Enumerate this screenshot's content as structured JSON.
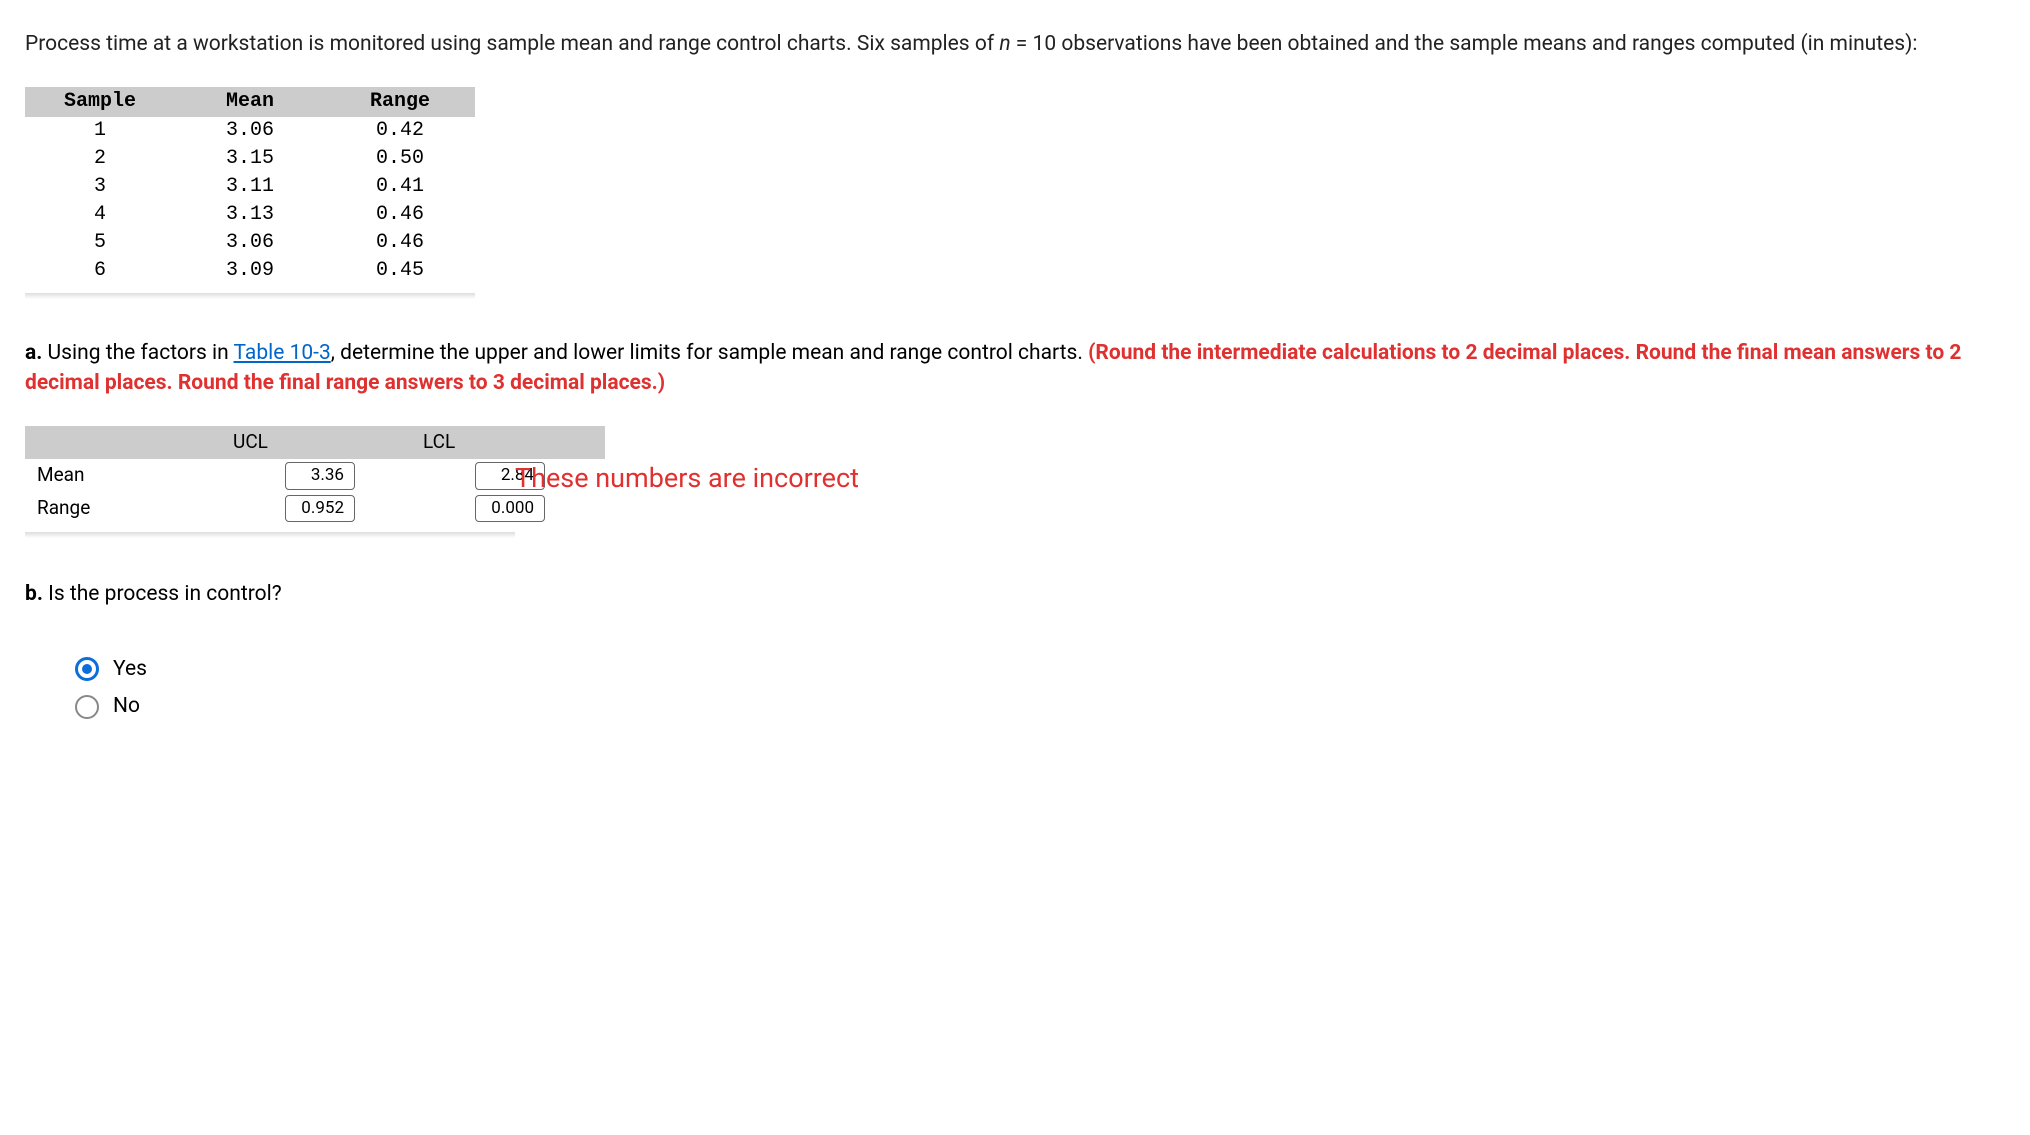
{
  "intro": {
    "text_before_n": "Process time at a workstation is monitored using sample mean and range control charts. Six samples of ",
    "n_letter": "n",
    "text_after_n": " = 10 observations have been obtained and the sample means and ranges computed (in minutes):"
  },
  "sample_table": {
    "headers": {
      "sample": "Sample",
      "mean": "Mean",
      "range": "Range"
    },
    "rows": [
      {
        "sample": "1",
        "mean": "3.06",
        "range": "0.42"
      },
      {
        "sample": "2",
        "mean": "3.15",
        "range": "0.50"
      },
      {
        "sample": "3",
        "mean": "3.11",
        "range": "0.41"
      },
      {
        "sample": "4",
        "mean": "3.13",
        "range": "0.46"
      },
      {
        "sample": "5",
        "mean": "3.06",
        "range": "0.46"
      },
      {
        "sample": "6",
        "mean": "3.09",
        "range": "0.45"
      }
    ]
  },
  "part_a": {
    "label": "a.",
    "text_before_link": " Using the factors in ",
    "link_text": "Table 10-3",
    "text_after_link": ", determine the upper and lower limits for sample mean and range control charts. ",
    "red_text": "(Round the intermediate calculations to 2 decimal places. Round the final mean answers to 2 decimal places. Round the final range answers to 3 decimal places.)"
  },
  "limits_table": {
    "ucl_header": "UCL",
    "lcl_header": "LCL",
    "rows": {
      "mean": {
        "label": "Mean",
        "ucl": "3.36",
        "lcl": "2.84"
      },
      "range": {
        "label": "Range",
        "ucl": "0.952",
        "lcl": "0.000"
      }
    }
  },
  "annotation": "These numbers are incorrect",
  "part_b": {
    "label": "b.",
    "question": " Is the process in control?"
  },
  "radio": {
    "yes": "Yes",
    "no": "No",
    "selected": "yes"
  }
}
